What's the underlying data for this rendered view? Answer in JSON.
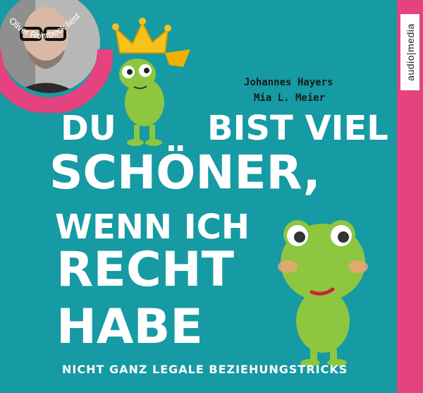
{
  "publisher": {
    "logo_text": "audio|media"
  },
  "narrator": {
    "label": "Oliver Rohrbeck liest"
  },
  "authors": [
    "Johannes Hayers",
    "Mia L. Meier"
  ],
  "title": {
    "line1_left": "DU",
    "line1_right": "BIST VIEL",
    "line2": "SCHÖNER,",
    "line3": "WENN ICH",
    "line4": "RECHT",
    "line5": "HABE"
  },
  "subtitle": "NICHT GANZ LEGALE BEZIEHUNGSTRICKS",
  "colors": {
    "background": "#169aa3",
    "pink": "#e5437f",
    "frog_green": "#8dc63f",
    "crown_gold": "#f7c21b",
    "title_white": "#ffffff"
  },
  "icons": [
    "crown-icon",
    "frog-icon",
    "narrator-photo"
  ]
}
